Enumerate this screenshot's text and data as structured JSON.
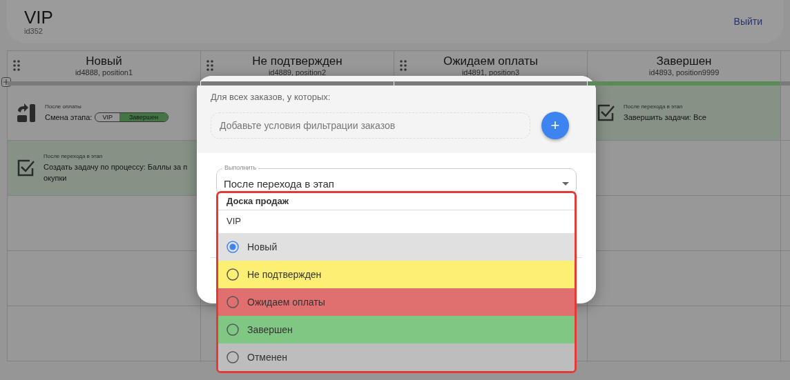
{
  "header": {
    "title": "VIP",
    "subtitle": "id352",
    "logout": "Выйти"
  },
  "columns": [
    {
      "title": "Новый",
      "meta": "id4888, position1",
      "color": "#7a7a7a",
      "cards": [
        {
          "kind": "stage_change",
          "highlighted": false,
          "trigger": "После оплаты",
          "action": "Смена этапа:",
          "from": "VIP",
          "to": "Завершен"
        },
        {
          "kind": "task",
          "highlighted": true,
          "trigger": "После перехода в этап",
          "action": "Создать задачу по процессу:  Баллы за покупки"
        }
      ]
    },
    {
      "title": "Не подтвержден",
      "meta": "id4889, position2",
      "color": "#7a7a7a"
    },
    {
      "title": "Ожидаем оплаты",
      "meta": "id4891, position3",
      "color": "#7a7a7a"
    },
    {
      "title": "Завершен",
      "meta": "id4893, position9999",
      "color": "#5a8a5a",
      "cards": [
        {
          "kind": "task",
          "highlighted": true,
          "trigger": "После перехода в этап",
          "action": "Завершить задачи:  Все"
        }
      ]
    }
  ],
  "modal": {
    "filter_label": "Для всех заказов, у которых:",
    "filter_placeholder": "Добавьте условия фильтрации заказов",
    "add_button": "+",
    "execute": {
      "label": "Выполнить",
      "value": "После перехода в этап"
    },
    "dropdown": {
      "board": "Доска продаж",
      "pipeline": "VIP",
      "options": [
        {
          "label": "Новый",
          "color": "#e0e0e0",
          "selected": true
        },
        {
          "label": "Не подтвержден",
          "color": "#fdef74",
          "selected": false
        },
        {
          "label": "Ожидаем оплаты",
          "color": "#e07070",
          "selected": false
        },
        {
          "label": "Завершен",
          "color": "#81c784",
          "selected": false
        },
        {
          "label": "Отменен",
          "color": "#bdbdbd",
          "selected": false
        }
      ]
    }
  }
}
